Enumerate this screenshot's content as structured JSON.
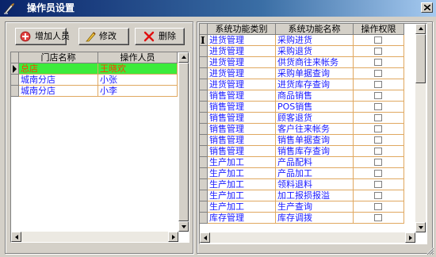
{
  "window": {
    "title": "操作员设置"
  },
  "toolbar": {
    "add_label": "增加人员",
    "edit_label": "修改",
    "delete_label": "删除"
  },
  "store_grid": {
    "columns": [
      "门店名称",
      "操作人员"
    ],
    "rows": [
      [
        "总店",
        "王晓欢"
      ],
      [
        "城南分店",
        "小张"
      ],
      [
        "城南分店",
        "小李"
      ]
    ],
    "selected_row": 0
  },
  "permission_grid": {
    "columns": [
      "系统功能类别",
      "系统功能名称",
      "操作权限"
    ],
    "rows": [
      [
        "进货管理",
        "采购进货"
      ],
      [
        "进货管理",
        "采购退货"
      ],
      [
        "进货管理",
        "供货商往来帐务"
      ],
      [
        "进货管理",
        "采购单据查询"
      ],
      [
        "进货管理",
        "进货库存查询"
      ],
      [
        "销售管理",
        "商品销售"
      ],
      [
        "销售管理",
        "POS销售"
      ],
      [
        "销售管理",
        "顾客退货"
      ],
      [
        "销售管理",
        "客户往来帐务"
      ],
      [
        "销售管理",
        "销售单据查询"
      ],
      [
        "销售管理",
        "销售库存查询"
      ],
      [
        "生产加工",
        "产品配料"
      ],
      [
        "生产加工",
        "产品加工"
      ],
      [
        "生产加工",
        "领料退料"
      ],
      [
        "生产加工",
        "加工报损报溢"
      ],
      [
        "生产加工",
        "生产查询"
      ],
      [
        "库存管理",
        "库存调拨"
      ]
    ]
  },
  "colors": {
    "selected_row_bg": "#3ceb3c",
    "selected_row_text": "#ff3b00",
    "link_text": "#1a1aff"
  }
}
